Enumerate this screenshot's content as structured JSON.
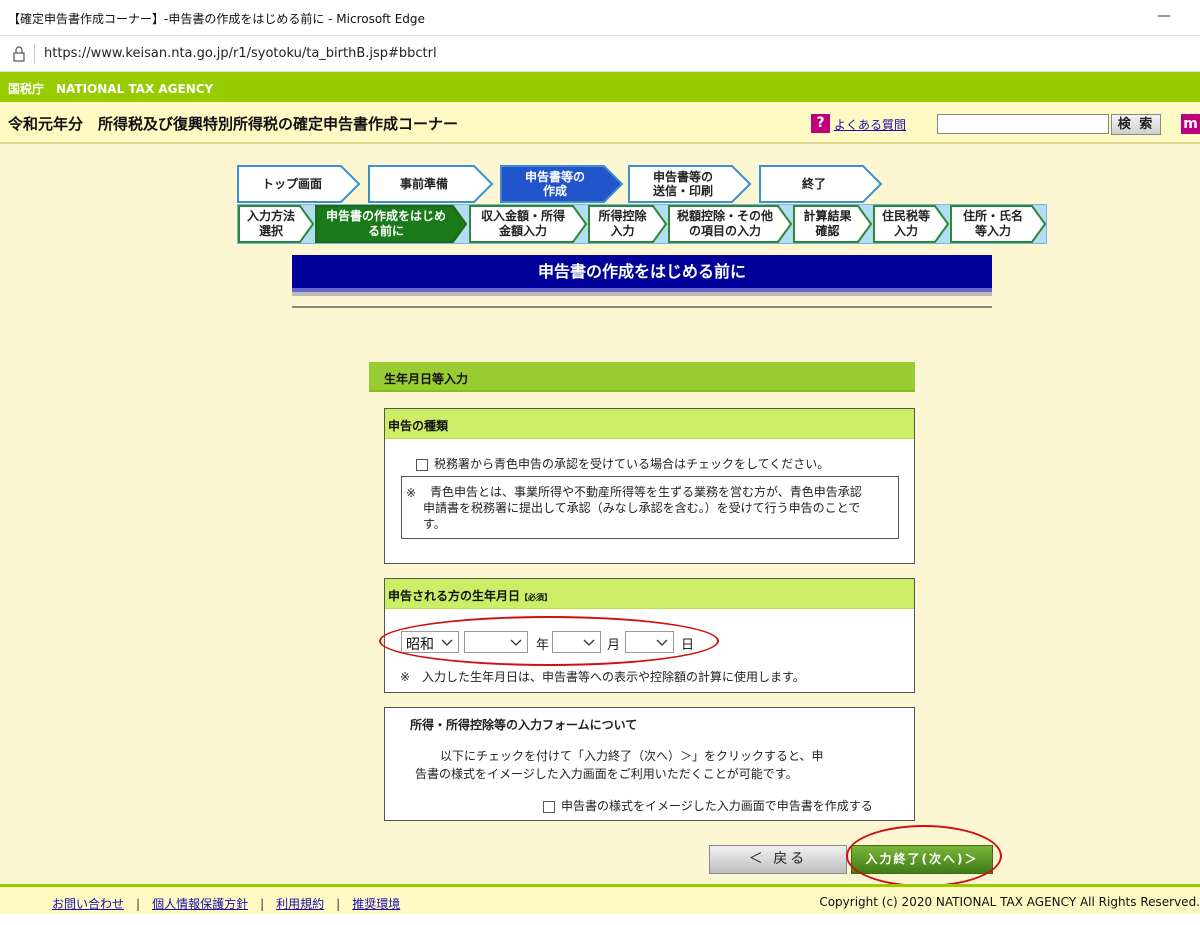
{
  "browser": {
    "window_title": "【確定申告書作成コーナー】-申告書の作成をはじめる前に - Microsoft Edge",
    "url": "https://www.keisan.nta.go.jp/r1/syotoku/ta_birthB.jsp#bbctrl",
    "minimize_glyph": "—"
  },
  "header": {
    "agency": "国税庁　NATIONAL TAX AGENCY",
    "site_title": "令和元年分　所得税及び復興特別所得税の確定申告書作成コーナー",
    "faq_icon": "?",
    "faq_link": "よくある質問",
    "search_value": "",
    "search_button": "検 索",
    "book_icon": "m"
  },
  "steps": [
    {
      "label_line1": "トップ画面",
      "label_line2": "",
      "active": false
    },
    {
      "label_line1": "事前準備",
      "label_line2": "",
      "active": false
    },
    {
      "label_line1": "申告書等の",
      "label_line2": "作成",
      "active": true
    },
    {
      "label_line1": "申告書等の",
      "label_line2": "送信・印刷",
      "active": false
    },
    {
      "label_line1": "終了",
      "label_line2": "",
      "active": false
    }
  ],
  "substeps": [
    {
      "label_line1": "入力方法",
      "label_line2": "選択",
      "active": false
    },
    {
      "label_line1": "申告書の作成をはじめ",
      "label_line2": "る前に",
      "active": true
    },
    {
      "label_line1": "収入金額・所得",
      "label_line2": "金額入力",
      "active": false
    },
    {
      "label_line1": "所得控除",
      "label_line2": "入力",
      "active": false
    },
    {
      "label_line1": "税額控除・その他",
      "label_line2": "の項目の入力",
      "active": false
    },
    {
      "label_line1": "計算結果",
      "label_line2": "確認",
      "active": false
    },
    {
      "label_line1": "住民税等",
      "label_line2": "入力",
      "active": false
    },
    {
      "label_line1": "住所・氏名",
      "label_line2": "等入力",
      "active": false
    }
  ],
  "page_title": "申告書の作成をはじめる前に",
  "section_title": "生年月日等入力",
  "panel_type": {
    "title": "申告の種類",
    "checkbox_label": "税務署から青色申告の承認を受けている場合はチェックをしてください。",
    "note_mark": "※",
    "note_line1": "青色申告とは、事業所得や不動産所得等を生ずる業務を営む方が、青色申告承認",
    "note_line2": "申請書を税務署に提出して承認（みなし承認を含む。）を受けて行う申告のことで",
    "note_line3": "す。"
  },
  "panel_dob": {
    "title": "申告される方の生年月日",
    "required": "【必須】",
    "era_value": "昭和",
    "year_value": "",
    "month_value": "",
    "day_value": "",
    "year_unit": "年",
    "month_unit": "月",
    "day_unit": "日",
    "note": "※　入力した生年月日は、申告書等への表示や控除額の計算に使用します。"
  },
  "panel_form": {
    "title": "所得・所得控除等の入力フォームについて",
    "line1": "以下にチェックを付けて「入力終了（次へ）＞」をクリックすると、申",
    "line2": "告書の様式をイメージした入力画面をご利用いただくことが可能です。",
    "checkbox_label": "申告書の様式をイメージした入力画面で申告書を作成する"
  },
  "buttons": {
    "back": "＜ 戻る",
    "next": "入力終了(次へ)＞"
  },
  "footer": {
    "links": [
      "お問い合わせ",
      "個人情報保護方針",
      "利用規約",
      "推奨環境"
    ],
    "copyright": "Copyright (c) 2020 NATIONAL TAX AGENCY All Rights Reserved."
  },
  "colors": {
    "agency_green": "#99cc00",
    "header_yellow": "#fff9c4",
    "heading_navy": "#000099",
    "active_step_blue": "#2255cc",
    "active_substep_green": "#1a7a1a",
    "annotation_red": "#d01010"
  }
}
